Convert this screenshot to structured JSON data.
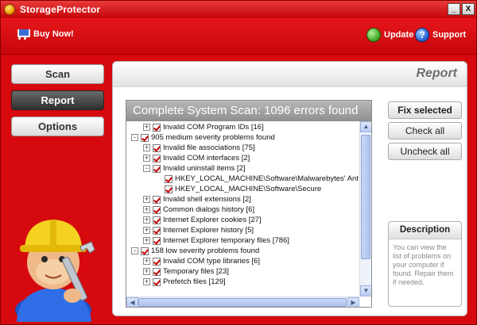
{
  "window": {
    "title": "StorageProtector",
    "minimize_label": "_",
    "close_label": "X"
  },
  "toolbar": {
    "buy_label": "Buy Now!",
    "update_label": "Update",
    "support_label": "Support",
    "support_glyph": "?"
  },
  "nav": {
    "scan_label": "Scan",
    "report_label": "Report",
    "options_label": "Options"
  },
  "panel": {
    "title": "Report",
    "scan_header": "Complete System Scan: 1096 errors found"
  },
  "tree": {
    "rows": [
      {
        "label": "Invalid COM Program IDs [16]",
        "expander": "+",
        "checked": true
      },
      {
        "label": "905 medium severity problems found",
        "expander": "-",
        "checked": true
      },
      {
        "label": "Invalid file associations [75]",
        "expander": "+",
        "checked": true
      },
      {
        "label": "Invalid COM interfaces [2]",
        "expander": "+",
        "checked": true
      },
      {
        "label": "Invalid uninstall items [2]",
        "expander": "-",
        "checked": true
      },
      {
        "label": "HKEY_LOCAL_MACHINE\\Software\\Malwarebytes' Anti-Malwar",
        "expander": "",
        "checked": true
      },
      {
        "label": "HKEY_LOCAL_MACHINE\\Software\\Secure",
        "expander": "",
        "checked": true
      },
      {
        "label": "Invalid shell extensions [2]",
        "expander": "+",
        "checked": true
      },
      {
        "label": "Common dialogs history [6]",
        "expander": "+",
        "checked": true
      },
      {
        "label": "Internet Explorer cookies [27]",
        "expander": "+",
        "checked": true
      },
      {
        "label": "Internet Explorer history [5]",
        "expander": "+",
        "checked": true
      },
      {
        "label": "Internet Explorer temporary files [786]",
        "expander": "+",
        "checked": true
      },
      {
        "label": "158 low severity problems found",
        "expander": "-",
        "checked": true
      },
      {
        "label": "Invalid COM type libraries [6]",
        "expander": "+",
        "checked": true
      },
      {
        "label": "Temporary files [23]",
        "expander": "+",
        "checked": true
      },
      {
        "label": "Prefetch files [129]",
        "expander": "+",
        "checked": true
      }
    ]
  },
  "actions": {
    "fix_label": "Fix selected",
    "check_all_label": "Check all",
    "uncheck_all_label": "Uncheck all"
  },
  "description": {
    "title": "Description",
    "text": "You can view the list of problems on your computer if found. Repair them if needed."
  },
  "colors": {
    "window_red": "#d6090e",
    "check_red": "#c40000"
  }
}
